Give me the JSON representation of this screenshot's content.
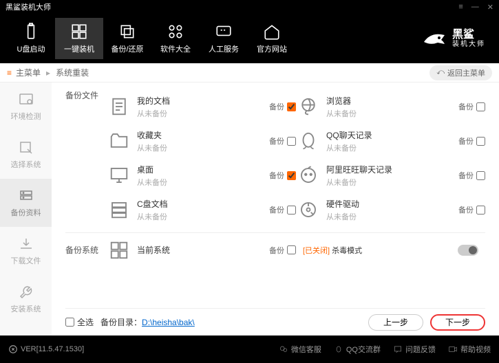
{
  "titlebar": {
    "title": "黑鲨装机大师"
  },
  "topnav": {
    "items": [
      {
        "label": "U盘启动"
      },
      {
        "label": "一键装机"
      },
      {
        "label": "备份/还原"
      },
      {
        "label": "软件大全"
      },
      {
        "label": "人工服务"
      },
      {
        "label": "官方网站"
      }
    ],
    "brand": "黑鲨",
    "brand_sub": "装机大师"
  },
  "breadcrumb": {
    "root": "主菜单",
    "current": "系统重装",
    "return": "返回主菜单"
  },
  "sidebar": {
    "items": [
      {
        "label": "环境检测"
      },
      {
        "label": "选择系统"
      },
      {
        "label": "备份资料"
      },
      {
        "label": "下载文件"
      },
      {
        "label": "安装系统"
      }
    ]
  },
  "content": {
    "section_backup_files": "备份文件",
    "section_backup_system": "备份系统",
    "backup_label": "备份",
    "never_backup": "从未备份",
    "items_left": [
      {
        "title": "我的文档",
        "checked": true
      },
      {
        "title": "收藏夹",
        "checked": false
      },
      {
        "title": "桌面",
        "checked": true
      },
      {
        "title": "C盘文档",
        "checked": false
      }
    ],
    "items_right": [
      {
        "title": "浏览器",
        "checked": false
      },
      {
        "title": "QQ聊天记录",
        "checked": false
      },
      {
        "title": "阿里旺旺聊天记录",
        "checked": false
      },
      {
        "title": "硬件驱动",
        "checked": false
      }
    ],
    "system_item": {
      "title": "当前系统",
      "checked": false
    },
    "virus_status": "[已关闭]",
    "virus_label": "杀毒模式",
    "select_all": "全选",
    "backup_dir_label": "备份目录：",
    "backup_dir_path": "D:\\heisha\\bak\\",
    "prev": "上一步",
    "next": "下一步"
  },
  "statusbar": {
    "version": "VER[11.5.47.1530]",
    "links": [
      "微信客服",
      "QQ交流群",
      "问题反馈",
      "帮助视频"
    ]
  }
}
